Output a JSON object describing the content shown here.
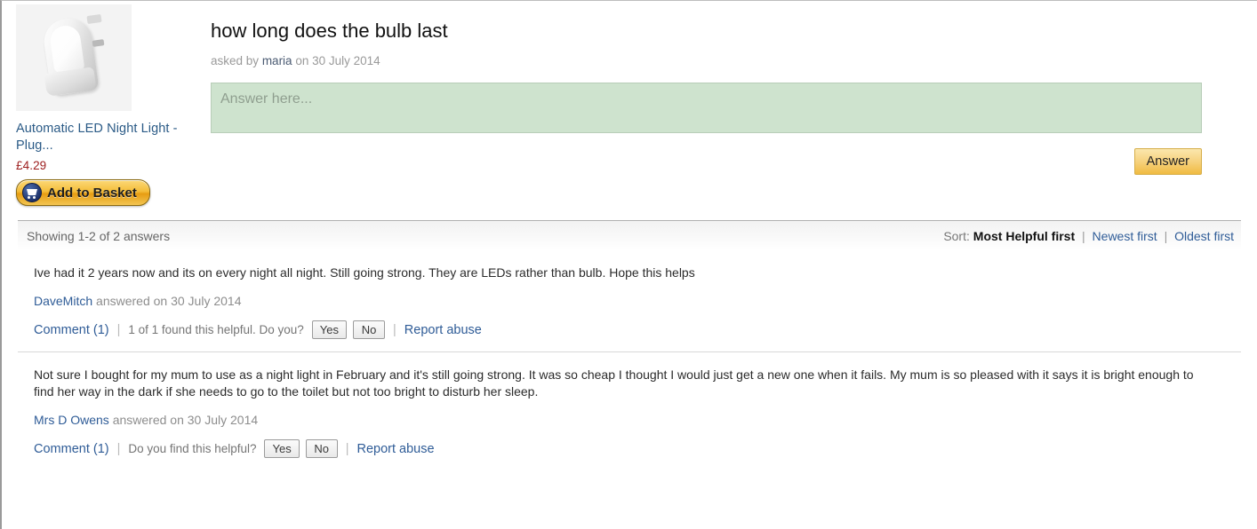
{
  "product": {
    "image_alt": "night-light-product-photo",
    "title": "Automatic LED Night Light - Plug...",
    "price": "£4.29",
    "add_to_basket_label": "Add to Basket"
  },
  "question": {
    "title": "how long does the bulb last",
    "asked_prefix": "asked by",
    "asker": "maria",
    "asked_suffix": "on 30 July 2014",
    "answer_placeholder": "Answer here...",
    "submit_label": "Answer"
  },
  "sort_bar": {
    "showing": "Showing 1-2 of 2 answers",
    "sort_label": "Sort:",
    "current": "Most Helpful first",
    "options": [
      "Newest first",
      "Oldest first"
    ],
    "separator": "|"
  },
  "answers": [
    {
      "text": "Ive had it 2 years now and its on every night all night. Still going strong. They are LEDs rather than bulb. Hope this helps",
      "author": "DaveMitch",
      "byline_suffix": "answered on 30 July 2014",
      "comment_label": "Comment (1)",
      "helpful_text": "1 of 1 found this helpful. Do you?",
      "yes_label": "Yes",
      "no_label": "No",
      "report_label": "Report abuse"
    },
    {
      "text": "Not sure I bought for my mum to use as a night light in February and it's still going strong. It was so cheap I thought I would just get a new one when it fails. My mum is so pleased with it says it is bright enough to find her way in the dark if she needs to go to the toilet but not too bright to disturb her sleep.",
      "author": "Mrs D Owens",
      "byline_suffix": "answered on 30 July 2014",
      "comment_label": "Comment (1)",
      "helpful_text": "Do you find this helpful?",
      "yes_label": "Yes",
      "no_label": "No",
      "report_label": "Report abuse"
    }
  ],
  "colors": {
    "link": "#2f5c97",
    "price": "#9c1c1c",
    "answer_box_bg": "#cee3ce",
    "accent_button": "#f0bb42"
  }
}
